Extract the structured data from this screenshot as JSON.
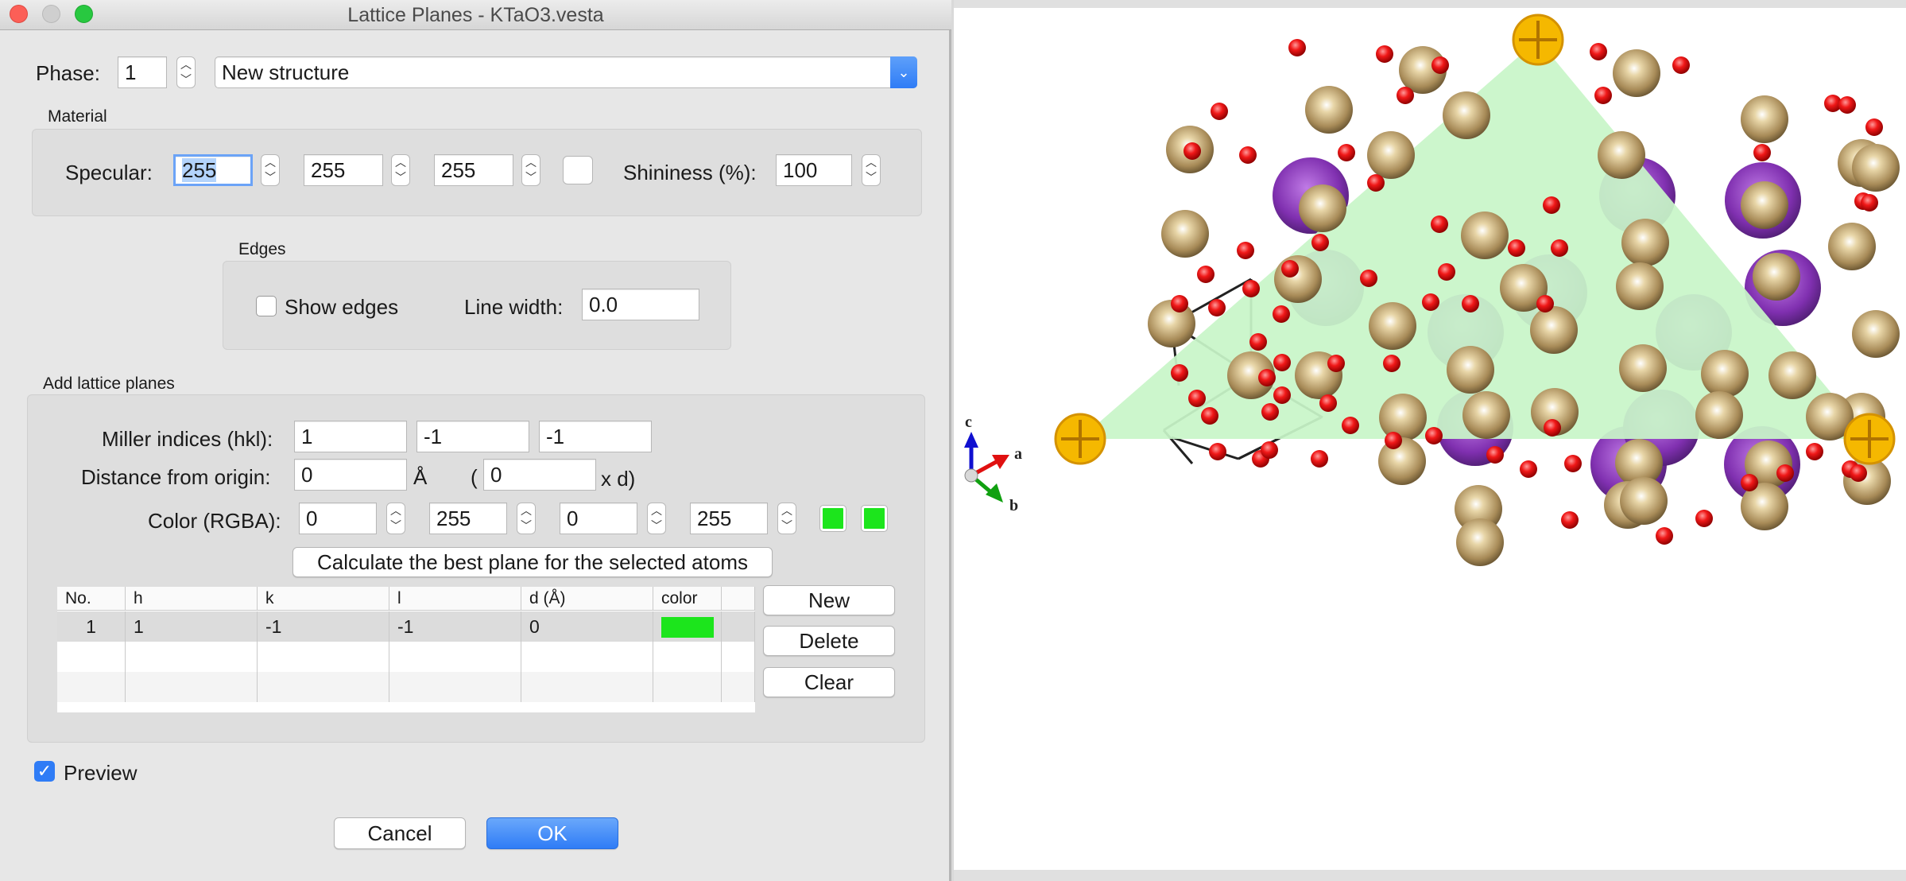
{
  "window": {
    "title": "Lattice Planes - KTaO3.vesta"
  },
  "phase": {
    "label": "Phase:",
    "value": "1",
    "structure": "New structure"
  },
  "material": {
    "title": "Material",
    "specular_label": "Specular:",
    "specular": [
      "255",
      "255",
      "255"
    ],
    "shininess_label": "Shininess (%):",
    "shininess": "100"
  },
  "edges": {
    "title": "Edges",
    "show_edges_label": "Show edges",
    "show_edges": false,
    "line_width_label": "Line width:",
    "line_width": "0.0"
  },
  "lattice": {
    "title": "Add lattice planes",
    "miller_label": "Miller indices (hkl):",
    "miller": [
      "1",
      "-1",
      "-1"
    ],
    "distance_label": "Distance from origin:",
    "distance": "0",
    "distance_unit": "Å",
    "paren_open": "(",
    "distance_d": "0",
    "xd_label": "x d)",
    "color_label": "Color (RGBA):",
    "rgba": [
      "0",
      "255",
      "0",
      "255"
    ],
    "plane_color": "#1ce51c",
    "calculate_button": "Calculate the best plane for the selected atoms"
  },
  "planes_table": {
    "headers": [
      "No.",
      "h",
      "k",
      "l",
      "d (Å)",
      "color"
    ],
    "rows": [
      {
        "no": "1",
        "h": "1",
        "k": "-1",
        "l": "-1",
        "d": "0",
        "color": "#1ce51c"
      }
    ]
  },
  "table_buttons": {
    "new": "New",
    "delete": "Delete",
    "clear": "Clear"
  },
  "preview": {
    "label": "Preview",
    "checked": true
  },
  "footer": {
    "cancel": "Cancel",
    "ok": "OK"
  },
  "axes": {
    "a": "a",
    "b": "b",
    "c": "c"
  },
  "colors": {
    "accent": "#2f7cf6",
    "plane_fill": "#c8f5c8",
    "atom_gold": "#b39a6b",
    "atom_red": "#e01010",
    "atom_purple": "#8a3bb5",
    "origin_marker": "#f5b800"
  }
}
